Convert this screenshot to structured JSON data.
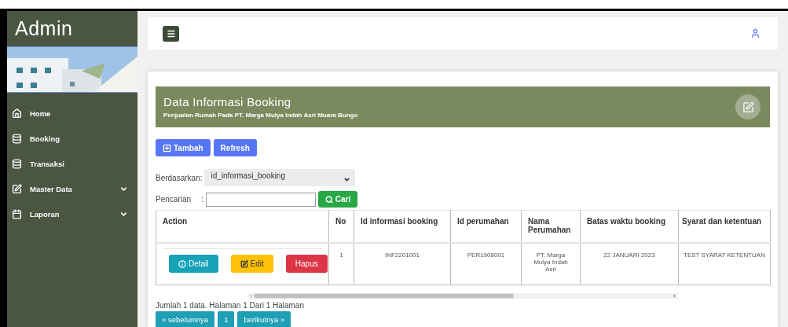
{
  "sidebar": {
    "title": "Admin",
    "items": [
      {
        "label": "Home",
        "expandable": false
      },
      {
        "label": "Booking",
        "expandable": false
      },
      {
        "label": "Transaksi",
        "expandable": false
      },
      {
        "label": "Master Data",
        "expandable": true
      },
      {
        "label": "Laporan",
        "expandable": true
      }
    ]
  },
  "card": {
    "title": "Data Informasi Booking",
    "subtitle": "Penjualan Rumah Pada PT. Marga Mulya Indah Asri Muara Bungo",
    "buttons": [
      {
        "label": "Tambah",
        "kind": "add"
      },
      {
        "label": "Refresh",
        "kind": "plain"
      }
    ],
    "filter": {
      "label": "Berdasarkan:",
      "value": "id_informasi_booking"
    },
    "search": {
      "label": "Pencarian",
      "colon": ":",
      "button": "Cari"
    },
    "table": {
      "columns": [
        "Action",
        "No",
        "Id informasi booking",
        "Id perumahan",
        "Nama Perumahan",
        "Batas waktu booking",
        "Syarat dan ketentuan"
      ],
      "rows": [
        {
          "cells": [
            {
              "buttons": [
                {
                  "label": "Detail",
                  "kind": "info"
                },
                {
                  "label": "Edit",
                  "kind": "warning"
                },
                {
                  "label": "Hapus",
                  "kind": "danger"
                }
              ]
            },
            "1",
            "INF2201001",
            "PER1908001",
            "PT. Marga Mulya Indah Asri",
            "22 JANUARI 2023",
            "TEST SYARAT KETENTUAN"
          ]
        }
      ]
    },
    "summary": "Jumlah 1 data. Halaman 1 Dari 1 Halaman",
    "pager": {
      "prev": "« sebelumnya",
      "pages": [
        "1"
      ],
      "next": "berikutnya »"
    }
  }
}
